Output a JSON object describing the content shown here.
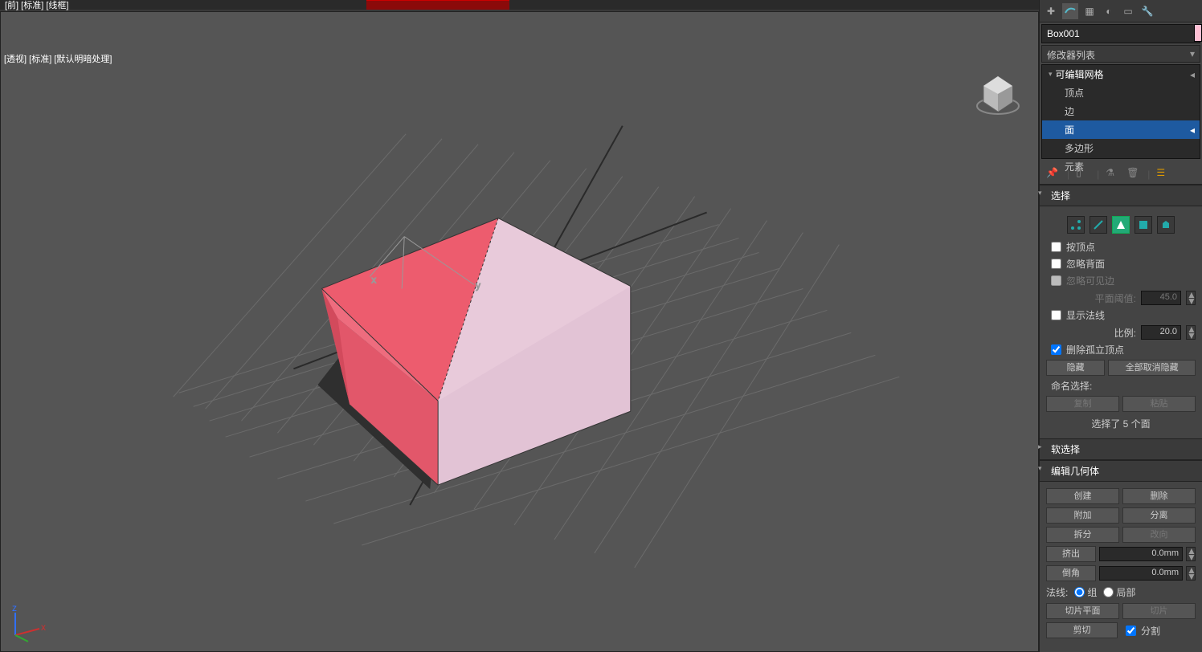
{
  "top_viewport_label": "[前] [标准] [线框]",
  "viewport_label": "[透视] [标准] [默认明暗处理]",
  "panel": {
    "object_name": "Box001",
    "modifier_list_label": "修改器列表",
    "stack": {
      "root": "可编辑网格",
      "items": [
        "顶点",
        "边",
        "面",
        "多边形",
        "元素"
      ],
      "selected_index": 2
    },
    "rollouts": {
      "selection": {
        "title": "选择",
        "by_vertex": "按顶点",
        "ignore_backface": "忽略背面",
        "ignore_visible_edge": "忽略可见边",
        "plane_threshold_label": "平面阈值:",
        "plane_threshold_value": "45.0",
        "show_normals": "显示法线",
        "scale_label": "比例:",
        "scale_value": "20.0",
        "delete_iso_verts": "删除孤立顶点",
        "hide_btn": "隐藏",
        "unhide_all_btn": "全部取消隐藏",
        "named_sel_label": "命名选择:",
        "copy_btn": "复制",
        "paste_btn": "粘贴",
        "status": "选择了 5 个面"
      },
      "soft_selection": {
        "title": "软选择"
      },
      "edit_geometry": {
        "title": "编辑几何体",
        "create_btn": "创建",
        "delete_btn": "删除",
        "attach_btn": "附加",
        "detach_btn": "分离",
        "split_btn": "拆分",
        "reverse_btn": "改向",
        "extrude_btn": "挤出",
        "extrude_value": "0.0mm",
        "chamfer_btn": "倒角",
        "chamfer_value": "0.0mm",
        "normal_label": "法线:",
        "normal_group": "组",
        "normal_local": "局部",
        "slice_plane_btn": "切片平面",
        "slice_btn": "切片",
        "cut_btn": "剪切",
        "split2_btn": "分割"
      }
    }
  }
}
